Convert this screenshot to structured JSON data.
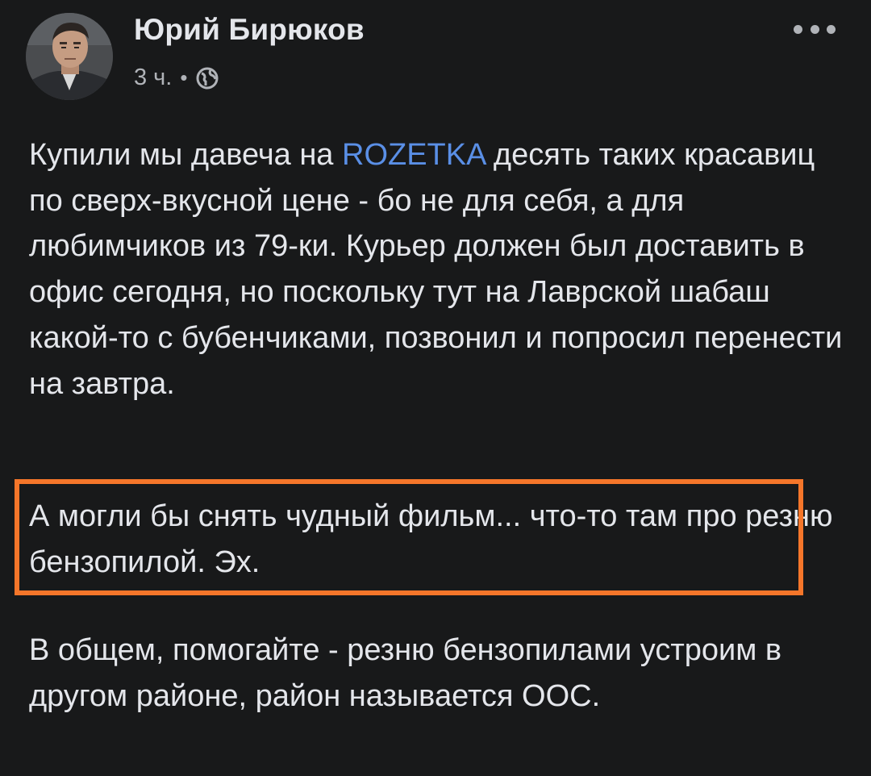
{
  "author": {
    "name": "Юрий Бирюков",
    "time": "3 ч.",
    "separator": "•",
    "privacy_icon": "globe-icon"
  },
  "menu": {
    "icon": "more-horizontal-icon"
  },
  "post": {
    "p1_before": "Купили мы давеча на ",
    "p1_mention": "ROZETKA",
    "p1_after": " десять таких красавиц по сверх-вкусной цене - бо не для себя, а для любимчиков из 79-ки. Курьер должен был доставить в офис сегодня, но поскольку тут на Лаврской шабаш какой-то с бубенчиками, позвонил и попросил перенести на завтра.",
    "p2": "А могли бы снять чудный фильм... что-то там про резню бензопилой. Эх.",
    "p3": "В общем, помогайте - резню бензопилами устроим в другом районе, район называется ООС."
  },
  "colors": {
    "background": "#18191a",
    "text": "#e4e6eb",
    "secondary_text": "#b0b3b8",
    "mention": "#5a8fe6",
    "highlight_border": "#f5762a"
  }
}
